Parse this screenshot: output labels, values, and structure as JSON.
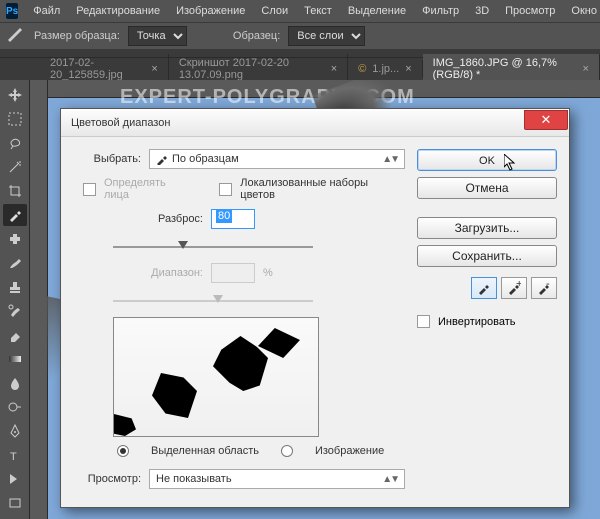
{
  "menu": {
    "items": [
      "Файл",
      "Редактирование",
      "Изображение",
      "Слои",
      "Текст",
      "Выделение",
      "Фильтр",
      "3D",
      "Просмотр",
      "Окно"
    ]
  },
  "optbar": {
    "label_sample": "Размер образца:",
    "sample_value": "Точка",
    "label_layers": "Образец:",
    "layers_value": "Все слои"
  },
  "tabs": [
    {
      "label": "2017-02-20_125859.jpg",
      "active": false
    },
    {
      "label": "Скриншот 2017-02-20 13.07.09.png",
      "active": false
    },
    {
      "label": "1.jp...",
      "active": false
    },
    {
      "label": "IMG_1860.JPG @ 16,7% (RGB/8) *",
      "active": true
    }
  ],
  "watermark": "EXPERT-POLYGRAPHY.COM",
  "dialog": {
    "title": "Цветовой диапазон",
    "select_label": "Выбрать:",
    "select_value": "По образцам",
    "detect_faces": "Определять лица",
    "localized": "Локализованные наборы цветов",
    "fuzziness_label": "Разброс:",
    "fuzziness_value": "80",
    "range_label": "Диапазон:",
    "range_value": "",
    "range_unit": "%",
    "radio_selection": "Выделенная область",
    "radio_image": "Изображение",
    "preview_label": "Просмотр:",
    "preview_value": "Не показывать",
    "btn_ok": "OK",
    "btn_cancel": "Отмена",
    "btn_load": "Загрузить...",
    "btn_save": "Сохранить...",
    "invert": "Инвертировать"
  }
}
